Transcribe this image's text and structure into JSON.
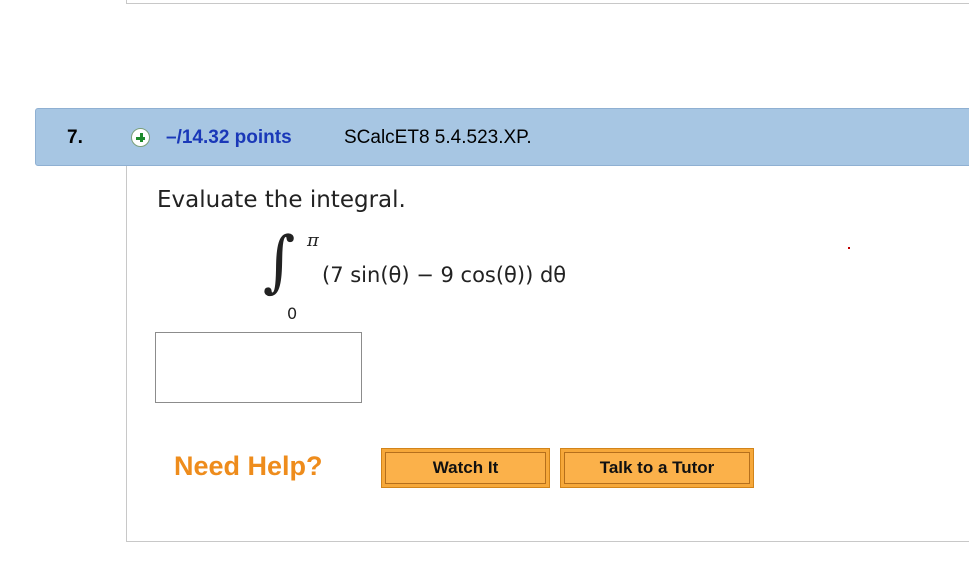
{
  "question": {
    "number": "7.",
    "points": "–/14.32 points",
    "source": "SCalcET8 5.4.523.XP.",
    "prompt": "Evaluate the integral.",
    "integral": {
      "sign": "∫",
      "upper_limit": "π",
      "lower_limit": "0",
      "integrand": "(7 sin(θ) − 9 cos(θ)) dθ"
    },
    "answer": {
      "value": "",
      "placeholder": ""
    }
  },
  "help": {
    "label": "Need Help?",
    "buttons": {
      "watch": "Watch It",
      "tutor": "Talk to a Tutor"
    }
  },
  "icons": {
    "expand": "plus-circle-icon"
  },
  "colors": {
    "header_bg": "#a7c6e3",
    "points_text": "#1a38b8",
    "help_text": "#ee8c1c",
    "button_bg": "#f6a83a",
    "plus_icon": "#1e8a2c"
  }
}
